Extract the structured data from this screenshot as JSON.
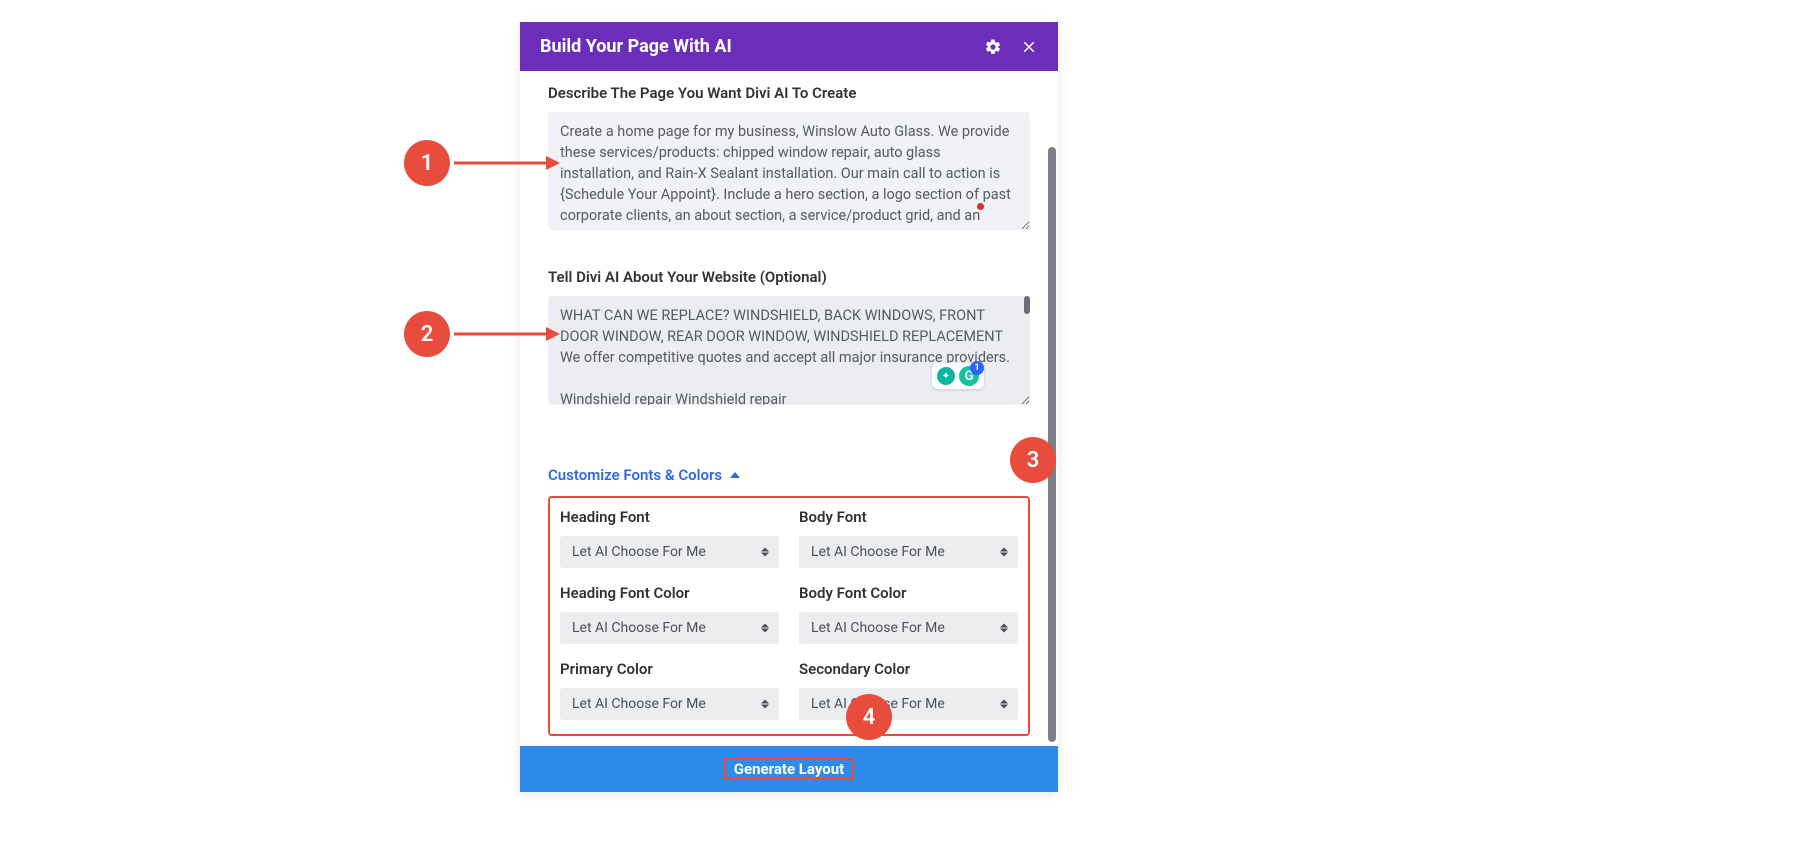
{
  "modal": {
    "title": "Build Your Page With AI",
    "describe_label": "Describe The Page You Want Divi AI To Create",
    "describe_value": "Create a home page for my business, Winslow Auto Glass. We provide these services/products: chipped window repair, auto glass installation, and Rain-X Sealant installation. Our main call to action is {Schedule Your Appoint}. Include a hero section, a logo section of past corporate clients, an about section, a service/product grid, and an email marketing opt-in form.",
    "website_label": "Tell Divi AI About Your Website (Optional)",
    "website_value": "WHAT CAN WE REPLACE? WINDSHIELD, BACK WINDOWS, FRONT DOOR WINDOW, REAR DOOR WINDOW, WINDSHIELD REPLACEMENT We offer competitive quotes and accept all major insurance providers.\n\nWindshield repair Windshield repair",
    "customize_label": "Customize Fonts & Colors",
    "grammarly_badge": "1",
    "options": {
      "heading_font": {
        "label": "Heading Font",
        "value": "Let AI Choose For Me"
      },
      "body_font": {
        "label": "Body Font",
        "value": "Let AI Choose For Me"
      },
      "heading_font_color": {
        "label": "Heading Font Color",
        "value": "Let AI Choose For Me"
      },
      "body_font_color": {
        "label": "Body Font Color",
        "value": "Let AI Choose For Me"
      },
      "primary_color": {
        "label": "Primary Color",
        "value": "Let AI Choose For Me"
      },
      "secondary_color": {
        "label": "Secondary Color",
        "value": "Let AI Choose For Me"
      }
    },
    "generate_label": "Generate Layout"
  },
  "annotations": {
    "a1": "1",
    "a2": "2",
    "a3": "3",
    "a4": "4"
  }
}
